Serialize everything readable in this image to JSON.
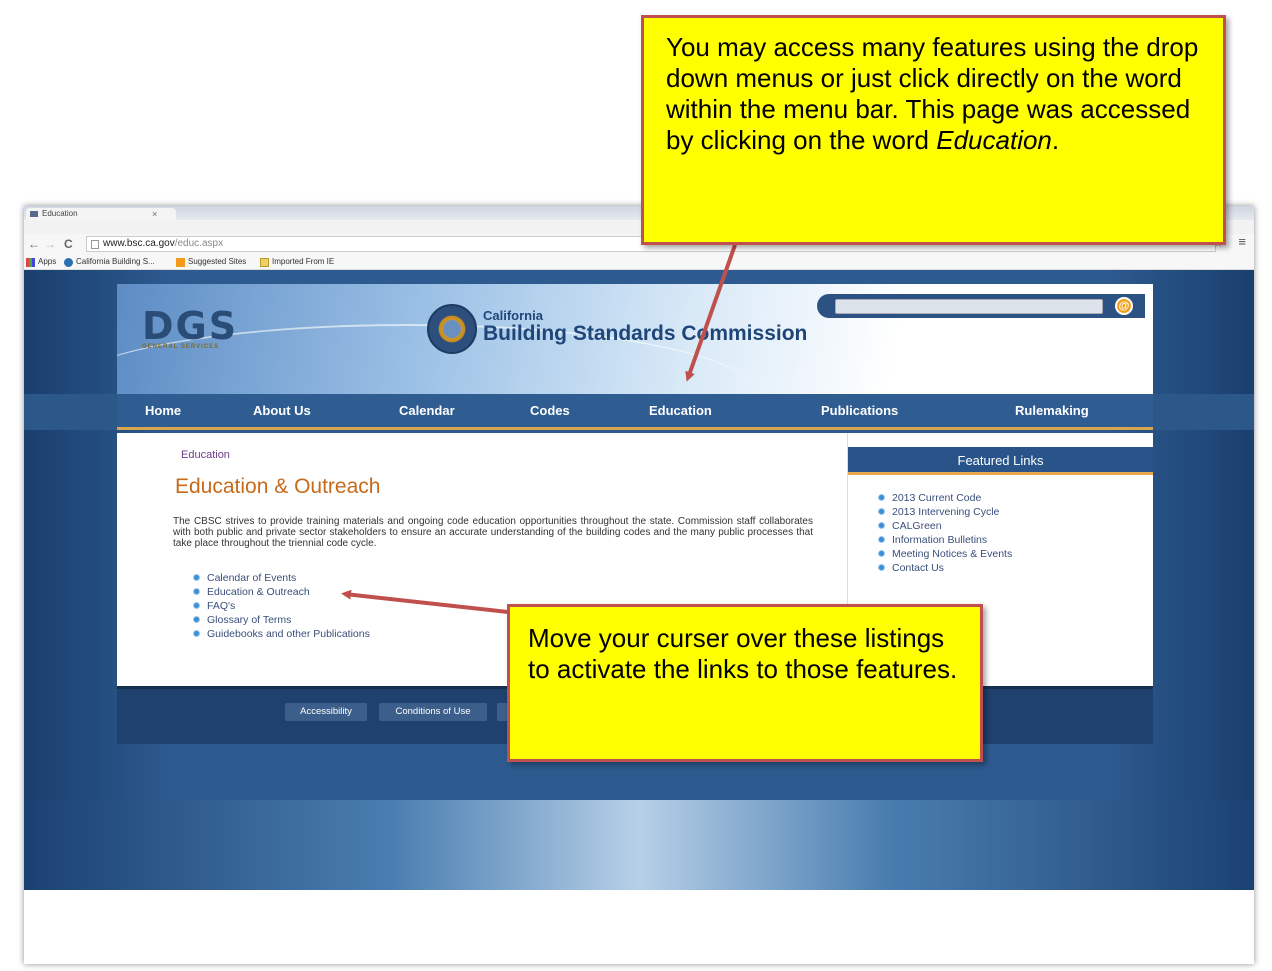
{
  "browser": {
    "tab_title": "Education",
    "tab_close": "×",
    "back": "←",
    "forward": "→",
    "reload": "C",
    "url_host": "www.bsc.ca.gov",
    "url_path": "/educ.aspx",
    "bookmarks": [
      {
        "label": "Apps"
      },
      {
        "label": "California Building S..."
      },
      {
        "label": "Suggested Sites"
      },
      {
        "label": "Imported From IE"
      }
    ]
  },
  "site": {
    "logo_text": "DGS",
    "logo_sub": "GENERAL SERVICES",
    "org_small": "California",
    "org_big": "Building Standards Commission",
    "search_btn": "@",
    "nav": [
      "Home",
      "About Us",
      "Calendar",
      "Codes",
      "Education",
      "Publications",
      "Rulemaking"
    ],
    "breadcrumb": "Education",
    "page_title": "Education & Outreach",
    "intro": "The CBSC strives to provide training materials and ongoing code education opportunities throughout the state. Commission staff collaborates with both public and private sector stakeholders to ensure an accurate understanding of the building codes and the many public processes that take place throughout the triennial code cycle.",
    "links": [
      "Calendar of Events",
      "Education & Outreach",
      "FAQ's",
      "Glossary of Terms",
      "Guidebooks and other Publications"
    ],
    "featured_title": "Featured Links",
    "featured": [
      "2013 Current Code",
      "2013 Intervening Cycle",
      "CALGreen",
      "Information Bulletins",
      "Meeting Notices & Events",
      "Contact Us"
    ],
    "footer": [
      "Accessibility",
      "Conditions of Use"
    ]
  },
  "callouts": {
    "top_part1": "You may access many features using the drop down menus or just click directly on the word within the menu bar.  This page was accessed by clicking on the word ",
    "top_italic": "Education",
    "top_end": ".",
    "bottom": "Move your curser over these listings to activate the links to those features."
  },
  "colors": {
    "callout_fill": "#ffff00",
    "callout_border": "#c0504d",
    "nav_bar": "#2f5d92",
    "title_orange": "#c76a1a"
  }
}
